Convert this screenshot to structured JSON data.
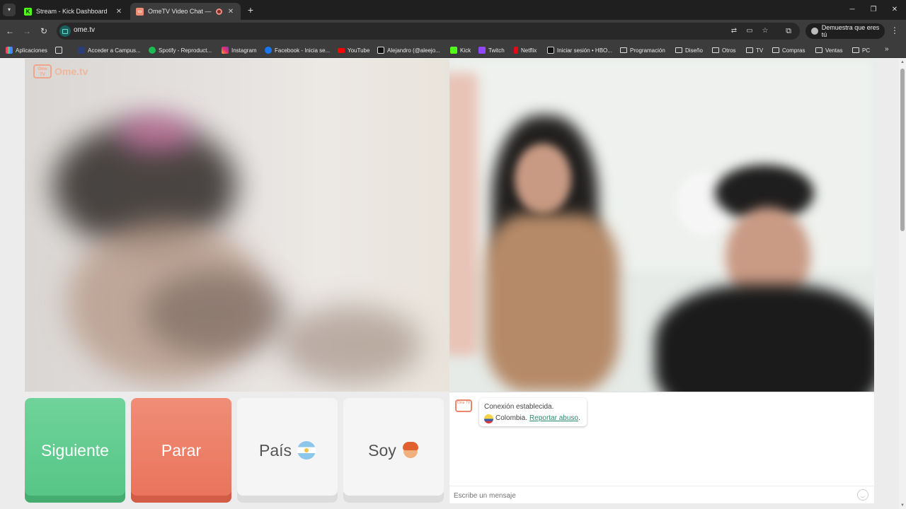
{
  "browser": {
    "tabs": [
      {
        "title": "Stream - Kick Dashboard",
        "favicon": "kick-icon",
        "active": false
      },
      {
        "title": "OmeTV Video Chat — Ome",
        "favicon": "ometv-icon",
        "active": true,
        "recording": true
      }
    ],
    "url": "ome.tv",
    "profile_label": "Demuestra que eres tú",
    "bookmarks": [
      {
        "label": "Aplicaciones",
        "icon": "apps-grid-icon"
      },
      {
        "label": "Acceder a Campus...",
        "icon": "campus-icon"
      },
      {
        "label": "Spotify - Reproduct...",
        "icon": "spotify-icon"
      },
      {
        "label": "Instagram",
        "icon": "instagram-icon"
      },
      {
        "label": "Facebook - Inicia se...",
        "icon": "facebook-icon"
      },
      {
        "label": "YouTube",
        "icon": "youtube-icon"
      },
      {
        "label": "Alejandro (@aleejo...",
        "icon": "tiktok-icon"
      },
      {
        "label": "Kick",
        "icon": "kick-icon"
      },
      {
        "label": "Twitch",
        "icon": "twitch-icon"
      },
      {
        "label": "Netflix",
        "icon": "netflix-icon"
      },
      {
        "label": "Iniciar sesión • HBO...",
        "icon": "hbo-icon"
      },
      {
        "label": "Programación",
        "icon": "folder-icon"
      },
      {
        "label": "Diseño",
        "icon": "folder-icon"
      },
      {
        "label": "Otros",
        "icon": "folder-icon"
      },
      {
        "label": "TV",
        "icon": "folder-icon"
      },
      {
        "label": "Compras",
        "icon": "folder-icon"
      },
      {
        "label": "Ventas",
        "icon": "folder-icon"
      },
      {
        "label": "PC",
        "icon": "folder-icon"
      }
    ]
  },
  "site": {
    "logo_text": "Ome.tv",
    "logo_badge": "Ome TV",
    "buttons": {
      "next": "Siguiente",
      "stop": "Parar",
      "country": "País",
      "gender": "Soy"
    },
    "chat": {
      "status": "Conexión establecida.",
      "country": "Colombia.",
      "report": "Reportar abuso",
      "report_suffix": ".",
      "placeholder": "Escribe un mensaje"
    }
  },
  "colors": {
    "next": "#5ccb8c",
    "stop": "#ec7d65",
    "accent": "#2a8a6e"
  }
}
